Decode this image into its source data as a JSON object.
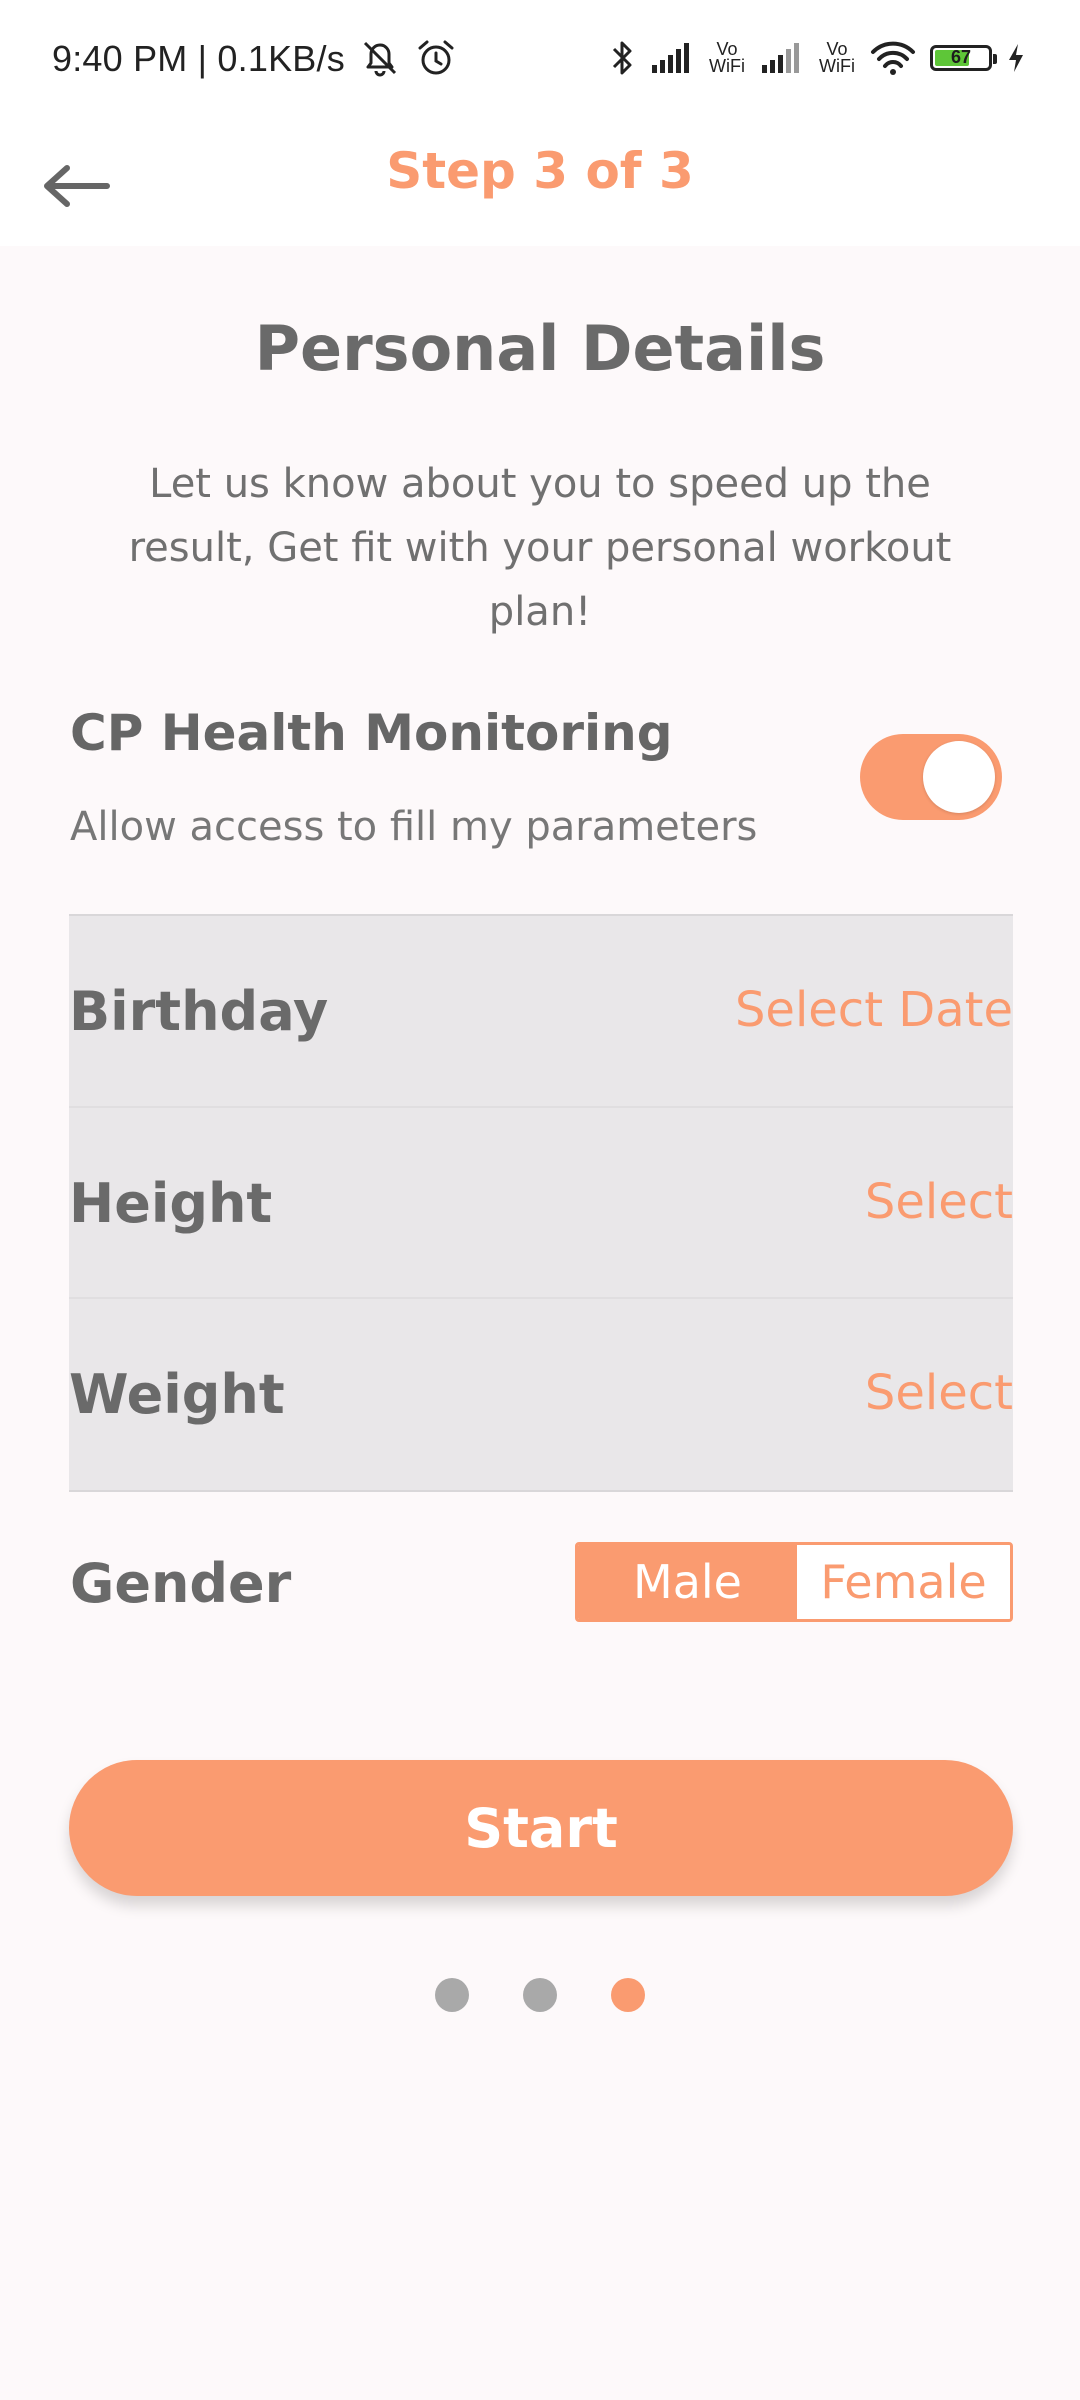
{
  "status_bar": {
    "time": "9:40 PM | 0.1KB/s",
    "vo_wifi_1": "Vo WiFi",
    "vo_wifi_2": "Vo WiFi",
    "battery_level": "67",
    "icons": [
      "mute-icon",
      "alarm-icon",
      "bluetooth-icon",
      "signal-icon",
      "signal-icon",
      "wifi-icon",
      "battery-icon",
      "charging-icon"
    ]
  },
  "header": {
    "back_icon": "arrow-left-icon",
    "step_title": "Step 3 of 3"
  },
  "main": {
    "title": "Personal Details",
    "subtitle": "Let us know about you to speed up the result, Get fit with your personal workout plan!",
    "health": {
      "title": "CP Health Monitoring",
      "description": "Allow access to fill my parameters",
      "toggle_on": true
    },
    "fields": [
      {
        "label": "Birthday",
        "value": "Select Date"
      },
      {
        "label": "Height",
        "value": "Select"
      },
      {
        "label": "Weight",
        "value": "Select"
      }
    ],
    "gender": {
      "label": "Gender",
      "options": [
        "Male",
        "Female"
      ],
      "selected": "Male"
    },
    "start_button": "Start",
    "pager": {
      "total": 3,
      "active_index": 2
    }
  },
  "colors": {
    "accent": "#fa9b70",
    "text": "#6a6a6a",
    "inactive_dot": "#a9a9a9"
  }
}
